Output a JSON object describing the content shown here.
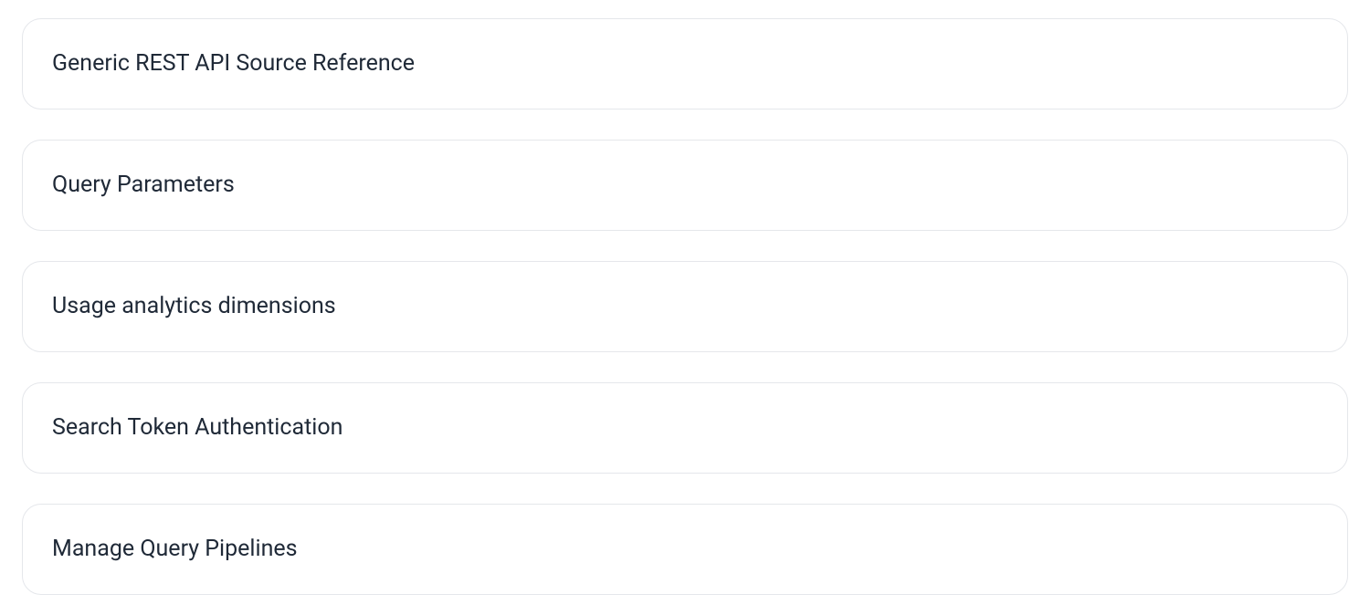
{
  "items": [
    {
      "label": "Generic REST API Source Reference"
    },
    {
      "label": "Query Parameters"
    },
    {
      "label": "Usage analytics dimensions"
    },
    {
      "label": "Search Token Authentication"
    },
    {
      "label": "Manage Query Pipelines"
    }
  ]
}
